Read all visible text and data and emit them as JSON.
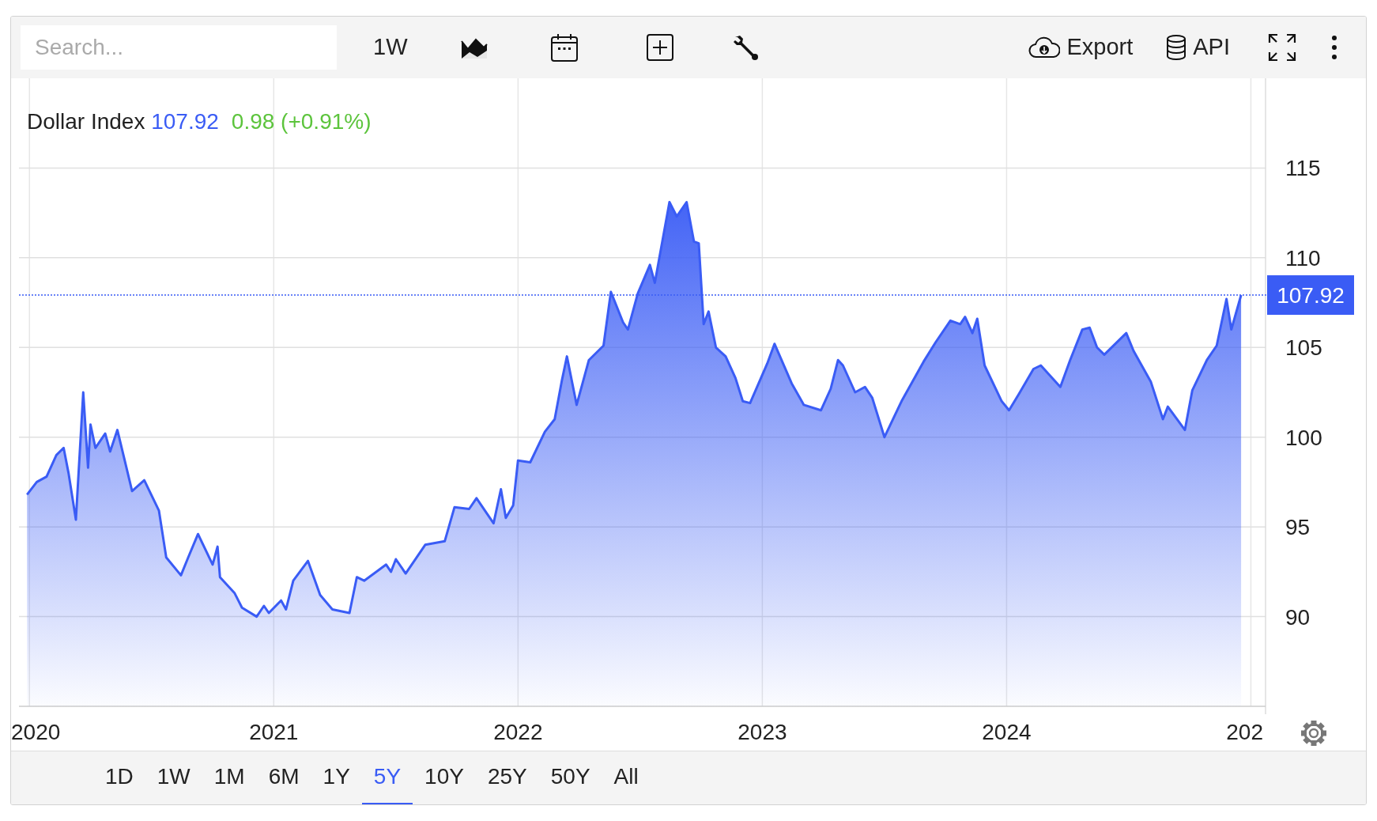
{
  "toolbar": {
    "search": {
      "placeholder": "Search..."
    },
    "interval": "1W",
    "export_label": "Export",
    "api_label": "API"
  },
  "chart": {
    "legend": {
      "name": "Dollar Index",
      "price": "107.92",
      "change": "0.98 (+0.91%)"
    },
    "cut_x_axis_label": "202",
    "chart_data": {
      "type": "area",
      "grid": true,
      "xlim": [
        2019.97,
        2025.06
      ],
      "ylim": [
        85,
        120
      ],
      "ref_lines": [
        {
          "axis": "y",
          "value": 107.92,
          "label": "107.92",
          "color": "#3a5cf5"
        }
      ],
      "xticks": [
        2020,
        2021,
        2022,
        2023,
        2024
      ],
      "yticks": [
        90,
        95,
        100,
        105,
        110,
        115
      ],
      "x": [
        2019.99,
        2020.03,
        2020.07,
        2020.11,
        2020.14,
        2020.16,
        2020.19,
        2020.22,
        2020.24,
        2020.25,
        2020.27,
        2020.31,
        2020.33,
        2020.36,
        2020.42,
        2020.47,
        2020.53,
        2020.56,
        2020.62,
        2020.65,
        2020.69,
        2020.75,
        2020.77,
        2020.78,
        2020.84,
        2020.87,
        2020.93,
        2020.96,
        2020.98,
        2021.03,
        2021.05,
        2021.08,
        2021.14,
        2021.19,
        2021.24,
        2021.31,
        2021.34,
        2021.37,
        2021.46,
        2021.48,
        2021.5,
        2021.54,
        2021.62,
        2021.7,
        2021.74,
        2021.8,
        2021.83,
        2021.9,
        2021.93,
        2021.95,
        2021.98,
        2022.0,
        2022.05,
        2022.11,
        2022.15,
        2022.18,
        2022.2,
        2022.24,
        2022.29,
        2022.35,
        2022.38,
        2022.43,
        2022.45,
        2022.49,
        2022.54,
        2022.56,
        2022.62,
        2022.65,
        2022.69,
        2022.72,
        2022.74,
        2022.76,
        2022.78,
        2022.81,
        2022.85,
        2022.89,
        2022.92,
        2022.95,
        2023.02,
        2023.05,
        2023.12,
        2023.17,
        2023.24,
        2023.28,
        2023.31,
        2023.33,
        2023.38,
        2023.42,
        2023.45,
        2023.5,
        2023.57,
        2023.66,
        2023.71,
        2023.77,
        2023.81,
        2023.83,
        2023.86,
        2023.88,
        2023.91,
        2023.98,
        2024.01,
        2024.05,
        2024.11,
        2024.14,
        2024.22,
        2024.26,
        2024.31,
        2024.34,
        2024.37,
        2024.4,
        2024.49,
        2024.52,
        2024.59,
        2024.64,
        2024.66,
        2024.73,
        2024.76,
        2024.82,
        2024.86,
        2024.9,
        2024.92,
        2024.96
      ],
      "series": [
        {
          "color": "#3a5cf5",
          "values": [
            96.8,
            97.5,
            97.8,
            99.0,
            99.4,
            98.0,
            95.4,
            102.5,
            98.3,
            100.7,
            99.4,
            100.2,
            99.2,
            100.4,
            97.0,
            97.6,
            95.9,
            93.3,
            92.3,
            93.3,
            94.6,
            92.9,
            93.9,
            92.2,
            91.3,
            90.5,
            90.0,
            90.6,
            90.2,
            90.9,
            90.4,
            92.0,
            93.1,
            91.2,
            90.4,
            90.2,
            92.2,
            92.0,
            92.9,
            92.5,
            93.2,
            92.4,
            94.0,
            94.2,
            96.1,
            96.0,
            96.6,
            95.2,
            97.1,
            95.5,
            96.2,
            98.7,
            98.6,
            100.3,
            101.0,
            103.2,
            104.5,
            101.8,
            104.3,
            105.1,
            108.1,
            106.4,
            106.0,
            108.0,
            109.6,
            108.6,
            113.1,
            112.3,
            113.1,
            110.9,
            110.8,
            106.3,
            107.0,
            105.0,
            104.5,
            103.3,
            102.0,
            101.9,
            104.1,
            105.2,
            103.0,
            101.8,
            101.5,
            102.7,
            104.3,
            104.0,
            102.5,
            102.8,
            102.2,
            100.0,
            102.0,
            104.2,
            105.3,
            106.5,
            106.3,
            106.7,
            105.8,
            106.6,
            104.0,
            102.0,
            101.5,
            102.4,
            103.8,
            104.0,
            102.8,
            104.3,
            106.0,
            106.1,
            105.0,
            104.6,
            105.8,
            104.8,
            103.1,
            101.0,
            101.7,
            100.4,
            102.6,
            104.3,
            105.1,
            107.7,
            106.0,
            107.92
          ]
        }
      ]
    }
  },
  "ranges": [
    {
      "label": "1D",
      "selected": false
    },
    {
      "label": "1W",
      "selected": false
    },
    {
      "label": "1M",
      "selected": false
    },
    {
      "label": "6M",
      "selected": false
    },
    {
      "label": "1Y",
      "selected": false
    },
    {
      "label": "5Y",
      "selected": true
    },
    {
      "label": "10Y",
      "selected": false
    },
    {
      "label": "25Y",
      "selected": false
    },
    {
      "label": "50Y",
      "selected": false
    },
    {
      "label": "All",
      "selected": false
    }
  ]
}
